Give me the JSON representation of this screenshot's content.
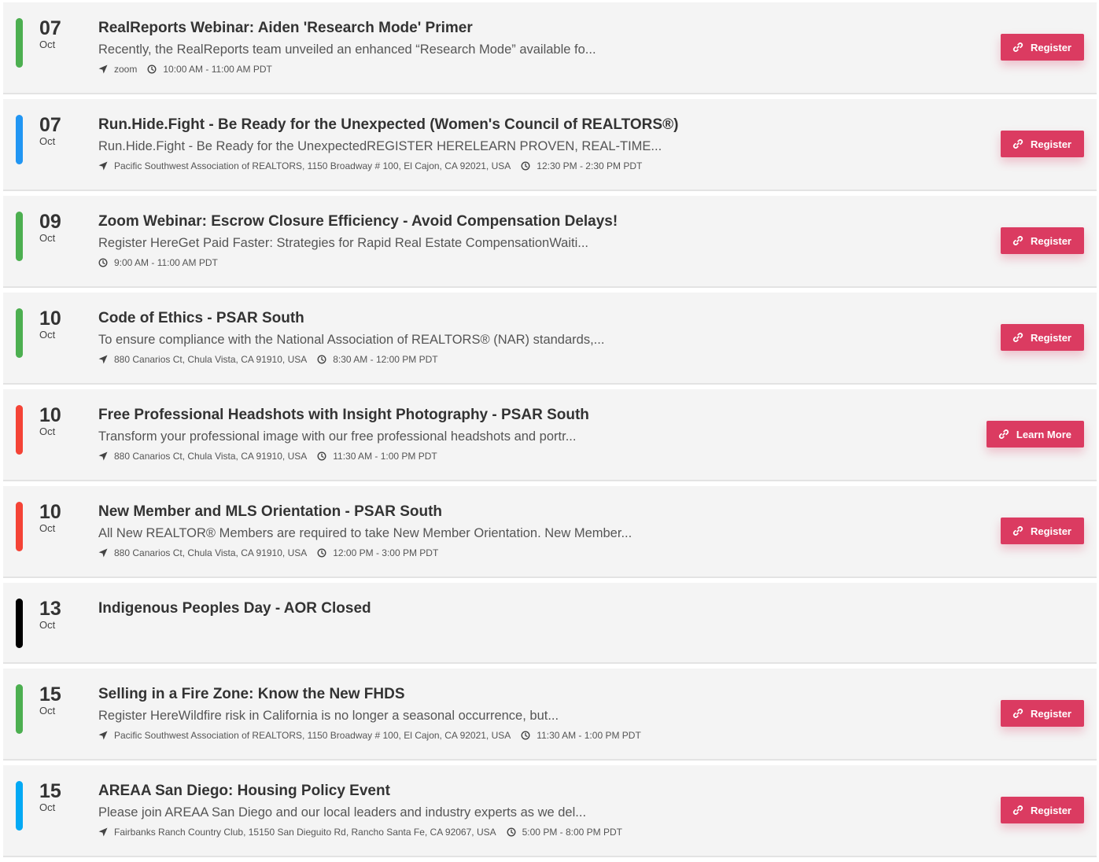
{
  "colors": {
    "green": "#4caf50",
    "blue": "#2196f3",
    "red": "#f44336",
    "black": "#000000",
    "light_blue": "#03a9f4",
    "button": "#db3b61"
  },
  "events": [
    {
      "day": "07",
      "month": "Oct",
      "color": "#4caf50",
      "title": "RealReports Webinar: Aiden 'Research Mode' Primer",
      "description": "Recently, the RealReports team unveiled an enhanced “Research Mode” available fo...",
      "location": "zoom",
      "time": "10:00 AM - 11:00 AM PDT",
      "button": "Register"
    },
    {
      "day": "07",
      "month": "Oct",
      "color": "#2196f3",
      "title": "Run.Hide.Fight - Be Ready for the Unexpected (Women's Council of REALTORS®)",
      "description": "Run.Hide.Fight - Be Ready for the UnexpectedREGISTER HERELEARN PROVEN, REAL-TIME...",
      "location": "Pacific Southwest Association of REALTORS, 1150 Broadway # 100, El Cajon, CA 92021, USA",
      "time": "12:30 PM - 2:30 PM PDT",
      "button": "Register"
    },
    {
      "day": "09",
      "month": "Oct",
      "color": "#4caf50",
      "title": "Zoom Webinar: Escrow Closure Efficiency - Avoid Compensation Delays!",
      "description": "Register HereGet Paid Faster: Strategies for Rapid Real Estate CompensationWaiti...",
      "location": "",
      "time": "9:00 AM - 11:00 AM PDT",
      "button": "Register"
    },
    {
      "day": "10",
      "month": "Oct",
      "color": "#4caf50",
      "title": "Code of Ethics - PSAR South",
      "description": "To ensure compliance with the National Association of REALTORS® (NAR) standards,...",
      "location": "880 Canarios Ct, Chula Vista, CA 91910, USA",
      "time": "8:30 AM - 12:00 PM PDT",
      "button": "Register"
    },
    {
      "day": "10",
      "month": "Oct",
      "color": "#f44336",
      "title": "Free Professional Headshots with Insight Photography - PSAR South",
      "description": "Transform your professional image with our free professional headshots and portr...",
      "location": "880 Canarios Ct, Chula Vista, CA 91910, USA",
      "time": "11:30 AM - 1:00 PM PDT",
      "button": "Learn More"
    },
    {
      "day": "10",
      "month": "Oct",
      "color": "#f44336",
      "title": "New Member and MLS Orientation - PSAR South",
      "description": "All New REALTOR® Members are required to take New Member Orientation. New Member...",
      "location": "880 Canarios Ct, Chula Vista, CA 91910, USA",
      "time": "12:00 PM - 3:00 PM PDT",
      "button": "Register"
    },
    {
      "day": "13",
      "month": "Oct",
      "color": "#000000",
      "title": "Indigenous Peoples Day - AOR Closed",
      "description": "",
      "location": "",
      "time": "",
      "button": ""
    },
    {
      "day": "15",
      "month": "Oct",
      "color": "#4caf50",
      "title": "Selling in a Fire Zone: Know the New FHDS",
      "description": "Register HereWildfire risk in California is no longer a seasonal occurrence, but...",
      "location": "Pacific Southwest Association of REALTORS, 1150 Broadway # 100, El Cajon, CA 92021, USA",
      "time": "11:30 AM - 1:00 PM PDT",
      "button": "Register"
    },
    {
      "day": "15",
      "month": "Oct",
      "color": "#03a9f4",
      "title": "AREAA San Diego: Housing Policy Event",
      "description": "Please join AREAA San Diego and our local leaders and industry experts as we del...",
      "location": "Fairbanks Ranch Country Club, 15150 San Dieguito Rd, Rancho Santa Fe, CA 92067, USA",
      "time": "5:00 PM - 8:00 PM PDT",
      "button": "Register"
    }
  ]
}
